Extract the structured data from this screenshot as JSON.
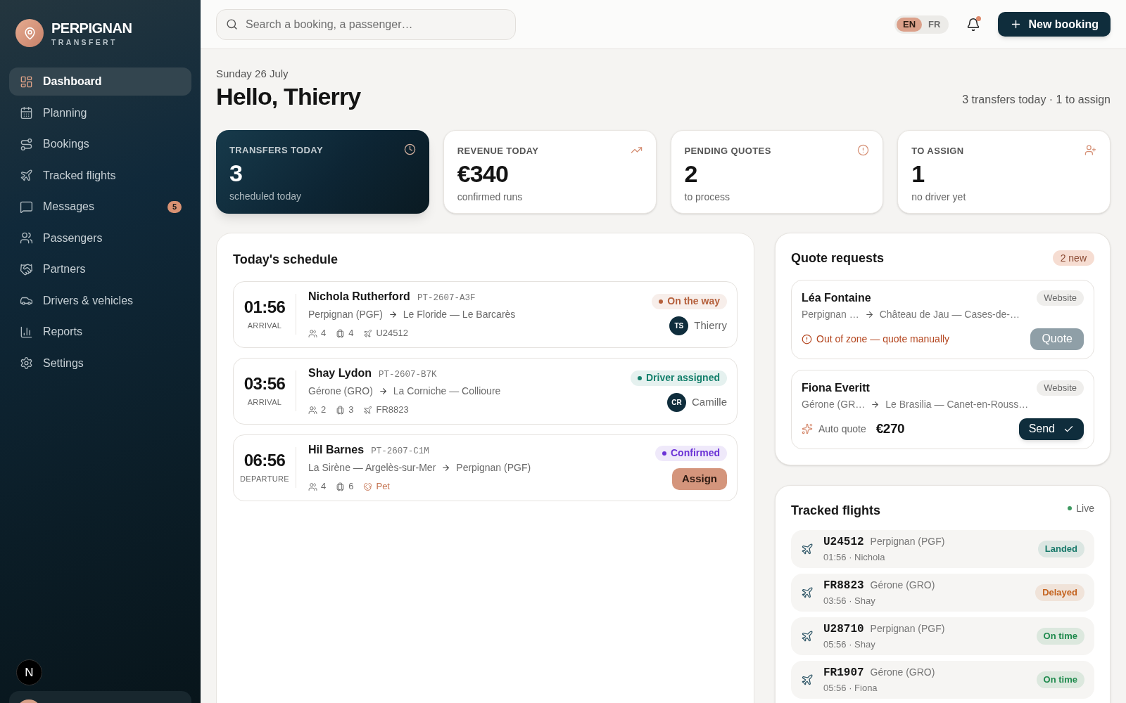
{
  "sidebar": {
    "brand": {
      "name": "PERPIGNAN",
      "tagline": "TRANSFERT"
    },
    "items": [
      {
        "label": "Dashboard",
        "selected": true
      },
      {
        "label": "Planning",
        "selected": false
      },
      {
        "label": "Bookings",
        "selected": false
      },
      {
        "label": "Tracked flights",
        "selected": false
      },
      {
        "label": "Messages",
        "selected": false,
        "badge": "5"
      },
      {
        "label": "Passengers",
        "selected": false
      },
      {
        "label": "Partners",
        "selected": false
      },
      {
        "label": "Drivers & vehicles",
        "selected": false
      },
      {
        "label": "Reports",
        "selected": false
      },
      {
        "label": "Settings",
        "selected": false
      }
    ],
    "dev_badge": {
      "label": "N"
    }
  },
  "header": {
    "search": {
      "placeholder": "Search a booking, a passenger…"
    },
    "languages": [
      {
        "label": "EN",
        "selected": true
      },
      {
        "label": "FR",
        "selected": false
      }
    ],
    "notifications": {
      "unread": true
    },
    "new_button": {
      "label": "New booking"
    }
  },
  "greeting": {
    "date": "Sunday 26 July",
    "title": "Hello, Thierry",
    "summary": "3 transfers today · 1 to assign"
  },
  "stats": [
    {
      "label": "TRANSFERS TODAY",
      "value": "3",
      "note": "scheduled today",
      "highlighted": true
    },
    {
      "label": "REVENUE TODAY",
      "value": "€340",
      "note": "confirmed runs",
      "highlighted": false
    },
    {
      "label": "PENDING QUOTES",
      "value": "2",
      "note": "to process",
      "highlighted": false
    },
    {
      "label": "TO ASSIGN",
      "value": "1",
      "note": "no driver yet",
      "highlighted": false
    }
  ],
  "schedule": {
    "title": "Today's schedule",
    "rows": [
      {
        "time": "01:56",
        "direction": "ARRIVAL",
        "name": "Nichola Rutherford",
        "ref": "PT-2607-A3F",
        "from": "Perpignan (PGF)",
        "to": "Le Floride — Le Barcarès",
        "meta": [
          {
            "kind": "passengers",
            "value": "4"
          },
          {
            "kind": "luggage",
            "value": "4"
          },
          {
            "kind": "flight",
            "value": "U24512"
          }
        ],
        "status": {
          "label": "On the way",
          "color": "#b5603c"
        },
        "assignee": {
          "kind": "driver",
          "initials": "TS",
          "name": "Thierry"
        }
      },
      {
        "time": "03:56",
        "direction": "ARRIVAL",
        "name": "Shay Lydon",
        "ref": "PT-2607-B7K",
        "from": "Gérone (GRO)",
        "to": "La Corniche — Collioure",
        "meta": [
          {
            "kind": "passengers",
            "value": "2"
          },
          {
            "kind": "luggage",
            "value": "3"
          },
          {
            "kind": "flight",
            "value": "FR8823"
          }
        ],
        "status": {
          "label": "Driver assigned",
          "color": "#14806c"
        },
        "assignee": {
          "kind": "driver",
          "initials": "CR",
          "name": "Camille"
        }
      },
      {
        "time": "06:56",
        "direction": "DEPARTURE",
        "name": "Hil Barnes",
        "ref": "PT-2607-C1M",
        "from": "La Sirène — Argelès-sur-Mer",
        "to": "Perpignan (PGF)",
        "meta": [
          {
            "kind": "passengers",
            "value": "4"
          },
          {
            "kind": "luggage",
            "value": "6"
          },
          {
            "kind": "pet",
            "value": "Pet"
          }
        ],
        "status": {
          "label": "Confirmed",
          "color": "#6b33d6"
        },
        "assignee": {
          "kind": "button",
          "label": "Assign"
        }
      }
    ]
  },
  "quotes": {
    "title": "Quote requests",
    "badge": "2 new",
    "items": [
      {
        "name": "Léa Fontaine",
        "source": "Website",
        "from": "Perpignan …",
        "to": "Château de Jau — Cases-de-…",
        "footer": {
          "kind": "warning",
          "text": "Out of zone — quote manually"
        },
        "action": {
          "label": "Quote",
          "kind": "muted"
        }
      },
      {
        "name": "Fiona Everitt",
        "source": "Website",
        "from": "Gérone (GR…",
        "to": "Le Brasilia — Canet-en-Rouss…",
        "footer": {
          "kind": "auto",
          "text": "Auto quote",
          "price": "€270"
        },
        "action": {
          "label": "Send",
          "kind": "primary"
        }
      }
    ]
  },
  "flights": {
    "title": "Tracked flights",
    "live": "Live",
    "items": [
      {
        "code": "U24512",
        "airport": "Perpignan (PGF)",
        "detail": "01:56 · Nichola",
        "status": {
          "label": "Landed",
          "color": "#17796a"
        }
      },
      {
        "code": "FR8823",
        "airport": "Gérone (GRO)",
        "detail": "03:56 · Shay",
        "status": {
          "label": "Delayed",
          "color": "#c4621d"
        }
      },
      {
        "code": "U28710",
        "airport": "Perpignan (PGF)",
        "detail": "05:56 · Shay",
        "status": {
          "label": "On time",
          "color": "#1f8a4d"
        }
      },
      {
        "code": "FR1907",
        "airport": "Gérone (GRO)",
        "detail": "05:56 · Fiona",
        "status": {
          "label": "On time",
          "color": "#1f8a4d"
        }
      }
    ]
  }
}
